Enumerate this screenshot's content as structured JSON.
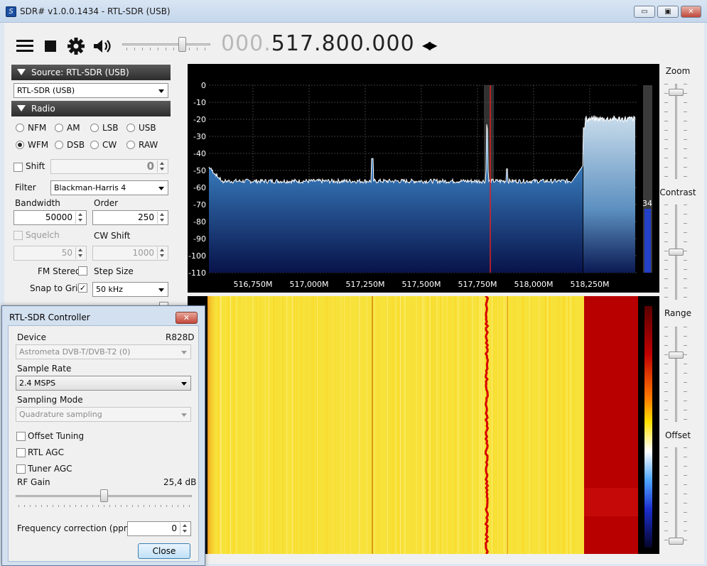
{
  "window": {
    "title": "SDR# v1.0.0.1434 - RTL-SDR (USB)",
    "app_icon": "sdrsharp-logo-icon",
    "controls": {
      "minimize": "▭",
      "maximize": "▣",
      "close": "✕"
    }
  },
  "toolbar": {
    "menu_icon": "hamburger-menu-icon",
    "stop_icon": "stop-icon",
    "settings_icon": "gear-icon",
    "audio_icon": "speaker-icon",
    "volume_level": 0.71,
    "frequency_dim": "000.",
    "frequency_main": "517.800.000",
    "tune_arrows": "◀▶"
  },
  "source": {
    "header": "Source: RTL-SDR (USB)",
    "device": "RTL-SDR (USB)"
  },
  "radio": {
    "header": "Radio",
    "modes": [
      {
        "label": "NFM",
        "selected": false
      },
      {
        "label": "AM",
        "selected": false
      },
      {
        "label": "LSB",
        "selected": false
      },
      {
        "label": "USB",
        "selected": false
      },
      {
        "label": "WFM",
        "selected": true
      },
      {
        "label": "DSB",
        "selected": false
      },
      {
        "label": "CW",
        "selected": false
      },
      {
        "label": "RAW",
        "selected": false
      }
    ],
    "shift_label": "Shift",
    "shift_value": "0",
    "filter_label": "Filter",
    "filter_value": "Blackman-Harris 4",
    "bandwidth_label": "Bandwidth",
    "bandwidth_value": "50000",
    "order_label": "Order",
    "order_value": "250",
    "squelch_label": "Squelch",
    "squelch_value": "50",
    "cwshift_label": "CW Shift",
    "cwshift_value": "1000",
    "fmstereo_label": "FM Stereo",
    "stepsize_label": "Step Size",
    "snap_label": "Snap to Grid",
    "snap_checked": "✓",
    "step_value": "50 kHz"
  },
  "spectrum": {
    "y_ticks": [
      "0",
      "-10",
      "-20",
      "-30",
      "-40",
      "-50",
      "-60",
      "-70",
      "-80",
      "-90",
      "-100",
      "-110"
    ],
    "x_ticks": [
      "516,750M",
      "517,000M",
      "517,250M",
      "517,500M",
      "517,750M",
      "518,000M",
      "518,250M"
    ],
    "level_readout": "34"
  },
  "right_panel": {
    "zoom_label": "Zoom",
    "contrast_label": "Contrast",
    "range_label": "Range",
    "offset_label": "Offset"
  },
  "rtl_dialog": {
    "title": "RTL-SDR Controller",
    "close_icon": "✕",
    "device_label": "Device",
    "device_tuner": "R828D",
    "device_value": "Astrometa DVB-T/DVB-T2 (0)",
    "sample_rate_label": "Sample Rate",
    "sample_rate_value": "2.4 MSPS",
    "sampling_mode_label": "Sampling Mode",
    "sampling_mode_value": "Quadrature sampling",
    "offset_tuning_label": "Offset Tuning",
    "rtl_agc_label": "RTL AGC",
    "tuner_agc_label": "Tuner AGC",
    "rf_gain_label": "RF Gain",
    "rf_gain_value": "25,4 dB",
    "rf_gain_level": 0.5,
    "freq_corr_label": "Frequency correction (ppm)",
    "freq_corr_value": "0",
    "close_button": "Close"
  },
  "colors": {
    "spectrum_fill_top": "#3a8fd6",
    "spectrum_fill_bottom": "#0a1a55",
    "waterfall_bg": "#f7e23a",
    "waterfall_hot": "#b80000"
  }
}
